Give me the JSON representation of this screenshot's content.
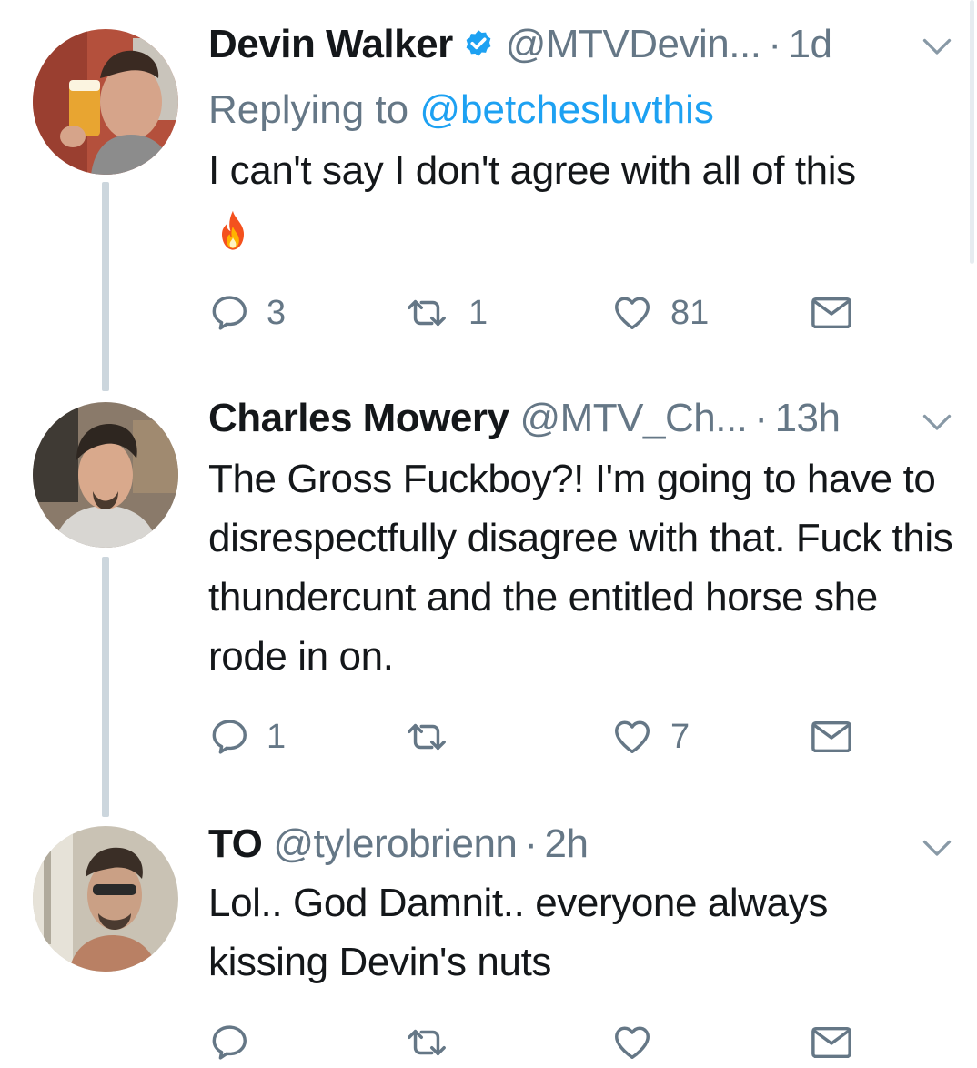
{
  "tweets": [
    {
      "name": "Devin Walker",
      "verified": true,
      "handle": "@MTVDevin...",
      "time": "1d",
      "replying_prefix": "Replying to ",
      "replying_to": "@betchesluvthis",
      "body": "I can't say I don't agree with all of this",
      "emoji": "🔥",
      "replies": "3",
      "retweets": "1",
      "likes": "81"
    },
    {
      "name": "Charles Mowery",
      "verified": false,
      "handle": "@MTV_Ch...",
      "time": "13h",
      "body": "The Gross Fuckboy?! I'm going to have to disrespectfully disagree with that. Fuck this thundercunt and the entitled horse she rode in on.",
      "replies": "1",
      "retweets": "",
      "likes": "7"
    },
    {
      "name": "TO",
      "verified": false,
      "handle": "@tylerobrienn",
      "time": "2h",
      "body": "Lol.. God Damnit.. everyone always kissing Devin's nuts",
      "replies": "",
      "retweets": "",
      "likes": ""
    }
  ],
  "separator": "·",
  "colors": {
    "text": "#14171a",
    "secondary": "#657786",
    "link": "#1da1f2",
    "thread": "#ccd6dd"
  },
  "icons": [
    "verified-badge-icon",
    "chevron-down-icon",
    "reply-icon",
    "retweet-icon",
    "heart-icon",
    "mail-icon",
    "fire-emoji-icon"
  ]
}
